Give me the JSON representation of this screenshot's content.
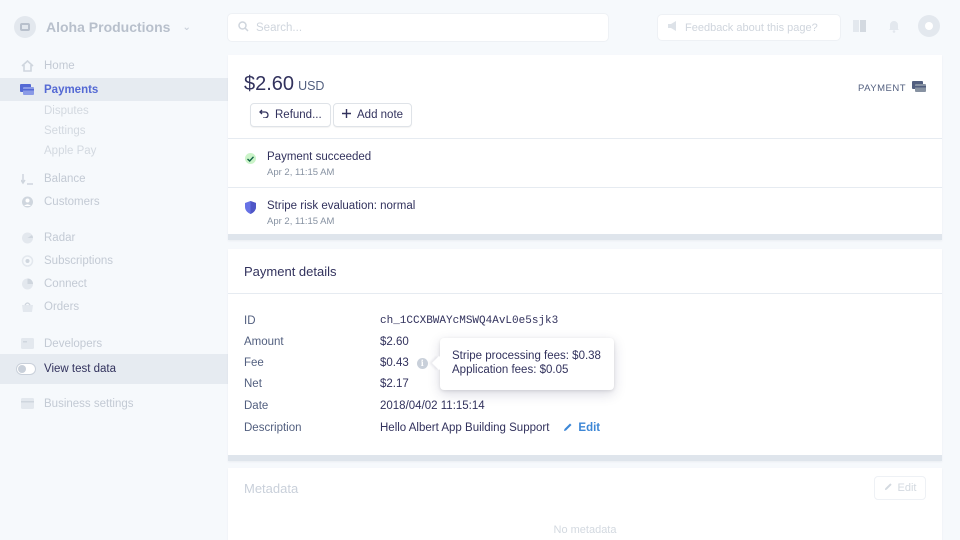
{
  "account": {
    "name": "Aloha Productions"
  },
  "search": {
    "placeholder": "Search..."
  },
  "feedback": {
    "label": "Feedback about this page?"
  },
  "nav": {
    "home": "Home",
    "payments": "Payments",
    "disputes": "Disputes",
    "settings": "Settings",
    "apple_pay": "Apple Pay",
    "balance": "Balance",
    "customers": "Customers",
    "radar": "Radar",
    "subscriptions": "Subscriptions",
    "connect": "Connect",
    "orders": "Orders",
    "developers": "Developers",
    "view_test_data": "View test data",
    "business_settings": "Business settings"
  },
  "payment": {
    "amount": "$2.60",
    "currency": "USD",
    "type_label": "PAYMENT",
    "refund_label": "Refund...",
    "add_note_label": "Add note"
  },
  "timeline": [
    {
      "title": "Payment succeeded",
      "time": "Apr 2, 11:15 AM"
    },
    {
      "title": "Stripe risk evaluation: normal",
      "time": "Apr 2, 11:15 AM"
    }
  ],
  "details": {
    "title": "Payment details",
    "rows": [
      {
        "key": "ID",
        "value": "ch_1CCXBWAYcMSWQ4AvL0e5sjk3"
      },
      {
        "key": "Amount",
        "value": "$2.60"
      },
      {
        "key": "Fee",
        "value": "$0.43"
      },
      {
        "key": "Net",
        "value": "$2.17"
      },
      {
        "key": "Date",
        "value": "2018/04/02 11:15:14"
      },
      {
        "key": "Description",
        "value": "Hello Albert App Building Support"
      }
    ],
    "edit_label": "Edit"
  },
  "tooltip": {
    "line1": "Stripe processing fees: $0.38",
    "line2": "Application fees: $0.05"
  },
  "metadata": {
    "title": "Metadata",
    "edit_label": "Edit",
    "empty_text": "No metadata"
  },
  "colors": {
    "accent": "#5469d4",
    "success": "#cbf4c9",
    "link": "#3d87d6",
    "risk_normal": "#6772e5"
  }
}
